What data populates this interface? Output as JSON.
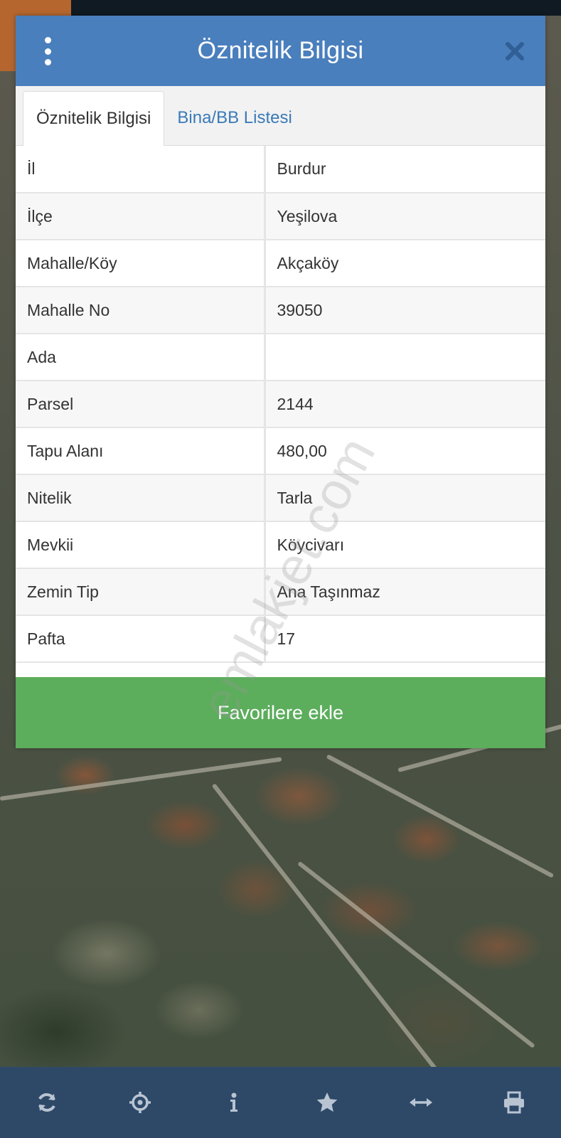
{
  "modal": {
    "title": "Öznitelik Bilgisi",
    "close_icon": "close-icon",
    "menu_icon": "more-vertical-icon"
  },
  "tabs": [
    {
      "label": "Öznitelik Bilgisi",
      "active": true
    },
    {
      "label": "Bina/BB Listesi",
      "active": false
    }
  ],
  "attributes": [
    {
      "key": "İl",
      "value": "Burdur"
    },
    {
      "key": "İlçe",
      "value": "Yeşilova"
    },
    {
      "key": "Mahalle/Köy",
      "value": "Akçaköy"
    },
    {
      "key": "Mahalle No",
      "value": "39050"
    },
    {
      "key": "Ada",
      "value": ""
    },
    {
      "key": "Parsel",
      "value": "2144"
    },
    {
      "key": "Tapu Alanı",
      "value": "480,00"
    },
    {
      "key": "Nitelik",
      "value": "Tarla"
    },
    {
      "key": "Mevkii",
      "value": "Köycivarı"
    },
    {
      "key": "Zemin Tip",
      "value": "Ana Taşınmaz"
    },
    {
      "key": "Pafta",
      "value": "17"
    }
  ],
  "favorite_button": "Favorilere ekle",
  "watermark": "emlakjet.com",
  "toolbar": [
    {
      "name": "refresh-icon"
    },
    {
      "name": "locate-icon"
    },
    {
      "name": "info-icon"
    },
    {
      "name": "star-icon"
    },
    {
      "name": "measure-icon"
    },
    {
      "name": "print-icon"
    }
  ],
  "colors": {
    "header": "#4a7fbd",
    "favorite": "#5cad5c",
    "toolbar": "#2e4968",
    "tab_link": "#3a7ab8"
  }
}
